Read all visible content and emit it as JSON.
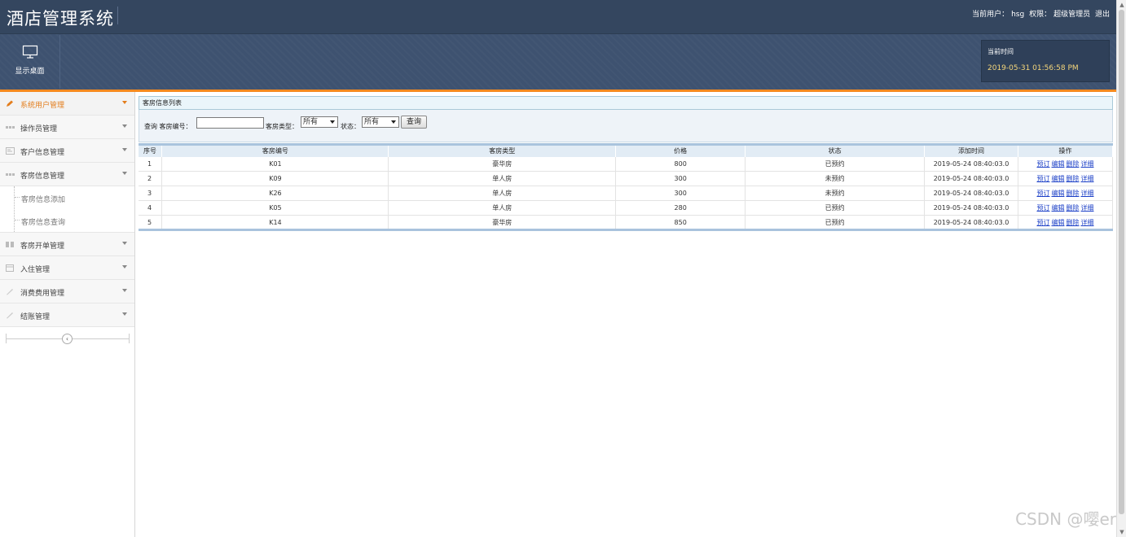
{
  "header": {
    "title": "酒店管理系统",
    "user_label": "当前用户：",
    "user_name": "hsg",
    "perm_label": "权限：",
    "perm_value": "超级管理员",
    "logout": "退出",
    "desktop_label": "显示桌面",
    "time_label": "当前时间",
    "time_value": "2019-05-31 01:56:58 PM"
  },
  "sidebar": {
    "items": [
      {
        "label": "系统用户管理",
        "icon": "pencil-icon"
      },
      {
        "label": "操作员管理",
        "icon": "grid-icon"
      },
      {
        "label": "客户信息管理",
        "icon": "card-icon"
      },
      {
        "label": "客房信息管理",
        "icon": "grid-icon"
      },
      {
        "label": "客房开单管理",
        "icon": "columns-icon"
      },
      {
        "label": "入住管理",
        "icon": "calendar-icon"
      },
      {
        "label": "消费费用管理",
        "icon": "brush-icon"
      },
      {
        "label": "结账管理",
        "icon": "brush-icon"
      }
    ],
    "sub_items": [
      "客房信息添加",
      "客房信息查询"
    ],
    "collapse_glyph": "‹"
  },
  "main": {
    "panel_title": "客房信息列表",
    "search": {
      "query_label": "查询 客房编号：",
      "room_no_value": "",
      "type_label": "客房类型：",
      "type_value": "所有",
      "status_label": "状态：",
      "status_value": "所有",
      "button": "查询"
    },
    "table": {
      "headers": [
        "序号",
        "客房编号",
        "客房类型",
        "价格",
        "状态",
        "添加时间",
        "操作"
      ],
      "rows": [
        {
          "idx": "1",
          "room": "K01",
          "type": "豪华房",
          "price": "800",
          "status": "已预约",
          "time": "2019-05-24 08:40:03.0"
        },
        {
          "idx": "2",
          "room": "K09",
          "type": "单人房",
          "price": "300",
          "status": "未预约",
          "time": "2019-05-24 08:40:03.0"
        },
        {
          "idx": "3",
          "room": "K26",
          "type": "单人房",
          "price": "300",
          "status": "未预约",
          "time": "2019-05-24 08:40:03.0"
        },
        {
          "idx": "4",
          "room": "K05",
          "type": "单人房",
          "price": "280",
          "status": "已预约",
          "time": "2019-05-24 08:40:03.0"
        },
        {
          "idx": "5",
          "room": "K14",
          "type": "豪华房",
          "price": "850",
          "status": "已预约",
          "time": "2019-05-24 08:40:03.0"
        }
      ],
      "actions": [
        "预订",
        "编辑",
        "删除",
        "详细"
      ]
    }
  },
  "watermark": "CSDN @嘤er",
  "colors": {
    "header": "#3e5270",
    "accent": "#f58a1f",
    "link": "#1b3fc7",
    "time": "#f5d67b"
  }
}
